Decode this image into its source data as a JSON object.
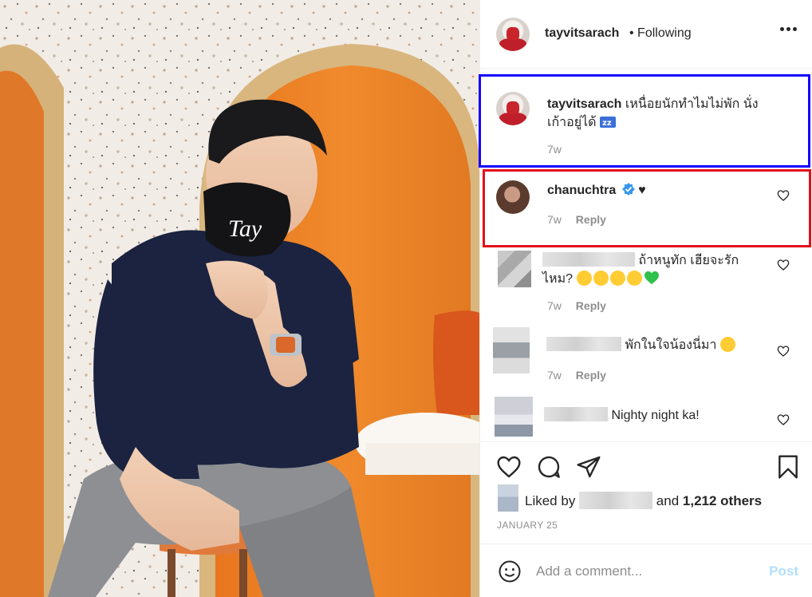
{
  "post": {
    "owner": "tayvitsarach",
    "follow_status": "• Following",
    "caption_username": "tayvitsarach",
    "caption_text": "เหนื่อยนักทำไมไม่พัก นั่งเก้าอี้อยู่ได้ 💤",
    "caption_line1": "เหนื่อยนักทำไมไม่พัก นั่ง",
    "caption_line2": "เก้าอยู่ได้",
    "caption_time": "7w",
    "mask_text": "Tay"
  },
  "comments": [
    {
      "username": "chanuchtra",
      "verified": true,
      "text": "♥",
      "time": "7w",
      "reply": "Reply"
    },
    {
      "username": "",
      "text_line1": "ถ้าหนูทัก เฮียจะรัก",
      "text_line2": "ไหม?",
      "time": "7w",
      "reply": "Reply"
    },
    {
      "username": "",
      "text": "พักในใจน้องนี่มา",
      "time": "7w",
      "reply": "Reply"
    },
    {
      "username": "",
      "text": "Nighty night ka!"
    }
  ],
  "likes": {
    "prefix": "Liked by",
    "suffix": "and",
    "others": "1,212 others"
  },
  "date": "JANUARY 25",
  "add_comment": {
    "placeholder": "Add a comment...",
    "post_label": "Post"
  },
  "colors": {
    "highlight_blue": "#1500ff",
    "highlight_red": "#e3101a",
    "verified": "#3897f0",
    "post_disabled": "#b2dffc"
  },
  "icons": [
    "more-options-icon",
    "heart-icon",
    "comment-icon",
    "share-icon",
    "bookmark-icon",
    "emoji-icon",
    "verified-badge-icon"
  ]
}
